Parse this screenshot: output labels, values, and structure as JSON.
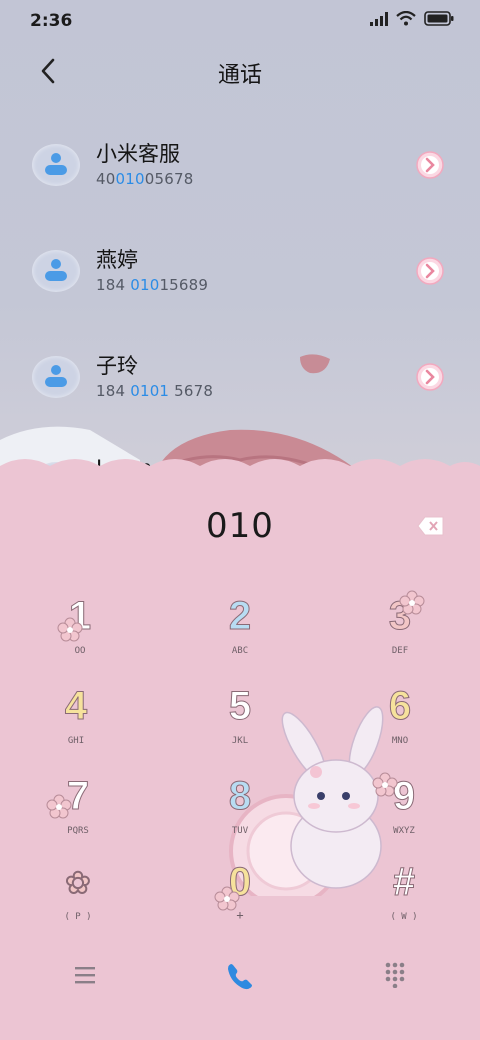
{
  "status": {
    "time": "2:36"
  },
  "header": {
    "title": "通话"
  },
  "contacts": [
    {
      "name": "小米客服",
      "num_pre": "40",
      "num_hl": "010",
      "num_post": "05678"
    },
    {
      "name": "燕婷",
      "num_pre": "184 ",
      "num_hl": "010",
      "num_post": "15689"
    },
    {
      "name": "子玲",
      "num_pre": "184 ",
      "num_hl": "0101",
      "num_post": " 5678"
    },
    {
      "name": "Jason"
    }
  ],
  "dialer": {
    "input": "010",
    "keys": [
      {
        "digit": "1",
        "letters": "OO",
        "color": "#ffffff"
      },
      {
        "digit": "2",
        "letters": "ABC",
        "color": "#b8dcf2"
      },
      {
        "digit": "3",
        "letters": "DEF",
        "color": "#f2c6c6"
      },
      {
        "digit": "4",
        "letters": "GHI",
        "color": "#f6e29c"
      },
      {
        "digit": "5",
        "letters": "JKL",
        "color": "#ffffff"
      },
      {
        "digit": "6",
        "letters": "MNO",
        "color": "#f6e29c"
      },
      {
        "digit": "7",
        "letters": "PQRS",
        "color": "#ffffff"
      },
      {
        "digit": "8",
        "letters": "TUV",
        "color": "#b8dcf2"
      },
      {
        "digit": "9",
        "letters": "WXYZ",
        "color": "#ffffff"
      },
      {
        "digit": "✿",
        "letters": "( P )",
        "color": "#f2c6c6"
      },
      {
        "digit": "0",
        "letters": "+",
        "color": "#f6e29c"
      },
      {
        "digit": "#",
        "letters": "( W )",
        "color": "#ffffff"
      }
    ]
  },
  "colors": {
    "accent": "#2b8ce6",
    "pad_bg": "#ecc5d3",
    "top_bg": "#c3c6d6"
  }
}
